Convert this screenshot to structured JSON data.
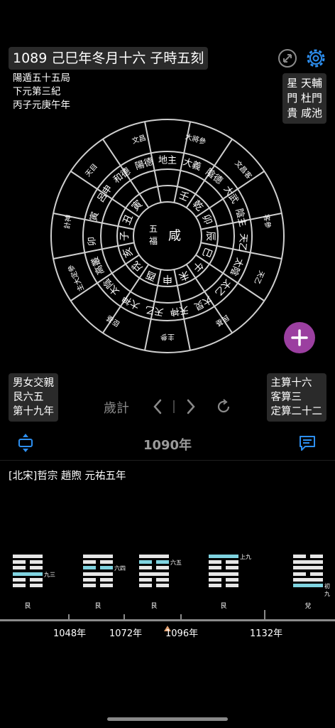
{
  "header": {
    "date_text": "1089 己巳年冬月十六 子時五刻"
  },
  "top_left_info": [
    "陽遁五十五局",
    "下元第三紀",
    "丙子元庚午年"
  ],
  "top_right_info": [
    "星 天輔",
    "門 杜門",
    "貴 咸池"
  ],
  "bottom_left_info": [
    "男女交親",
    "艮六五",
    "第十九年"
  ],
  "bottom_right_info": [
    "主算十六",
    "客算三",
    "定算二十二"
  ],
  "controls": {
    "mode_label": "歲計"
  },
  "year_title": "1090年",
  "dynasty_text": "[北宋]哲宗 趙煦 元祐五年",
  "wheel": {
    "center": [
      "五",
      "福",
      "咸"
    ],
    "inner": [
      "壬",
      "乾",
      "卯",
      "辰",
      "巳",
      "午",
      "未",
      "申",
      "酉",
      "戌",
      "亥",
      "子",
      "丑",
      "寅"
    ],
    "ring3": [
      "地主",
      "大義",
      "陰德",
      "大武",
      "陰主",
      "天乙",
      "太陰",
      "太乙",
      "大炅",
      "天神",
      "天乙",
      "大神",
      "太陰",
      "高叢",
      "卯",
      "寅",
      "呂申",
      "和德",
      "陽德"
    ],
    "outer": [
      "主參",
      "臣基",
      "主大定參",
      "計神",
      "天目",
      "文昌",
      "大將參",
      "文昌客",
      "客參",
      "天乙",
      "民基"
    ]
  },
  "hexagrams": [
    {
      "name": "艮",
      "label": "九三"
    },
    {
      "name": "艮",
      "label": "六四"
    },
    {
      "name": "艮",
      "label": "六五"
    },
    {
      "name": "艮",
      "label": "上九"
    },
    {
      "name": "兌",
      "label": "初九"
    }
  ],
  "timeline": {
    "ticks": [
      "1048年",
      "1072年",
      "1096年",
      "1132年"
    ]
  }
}
